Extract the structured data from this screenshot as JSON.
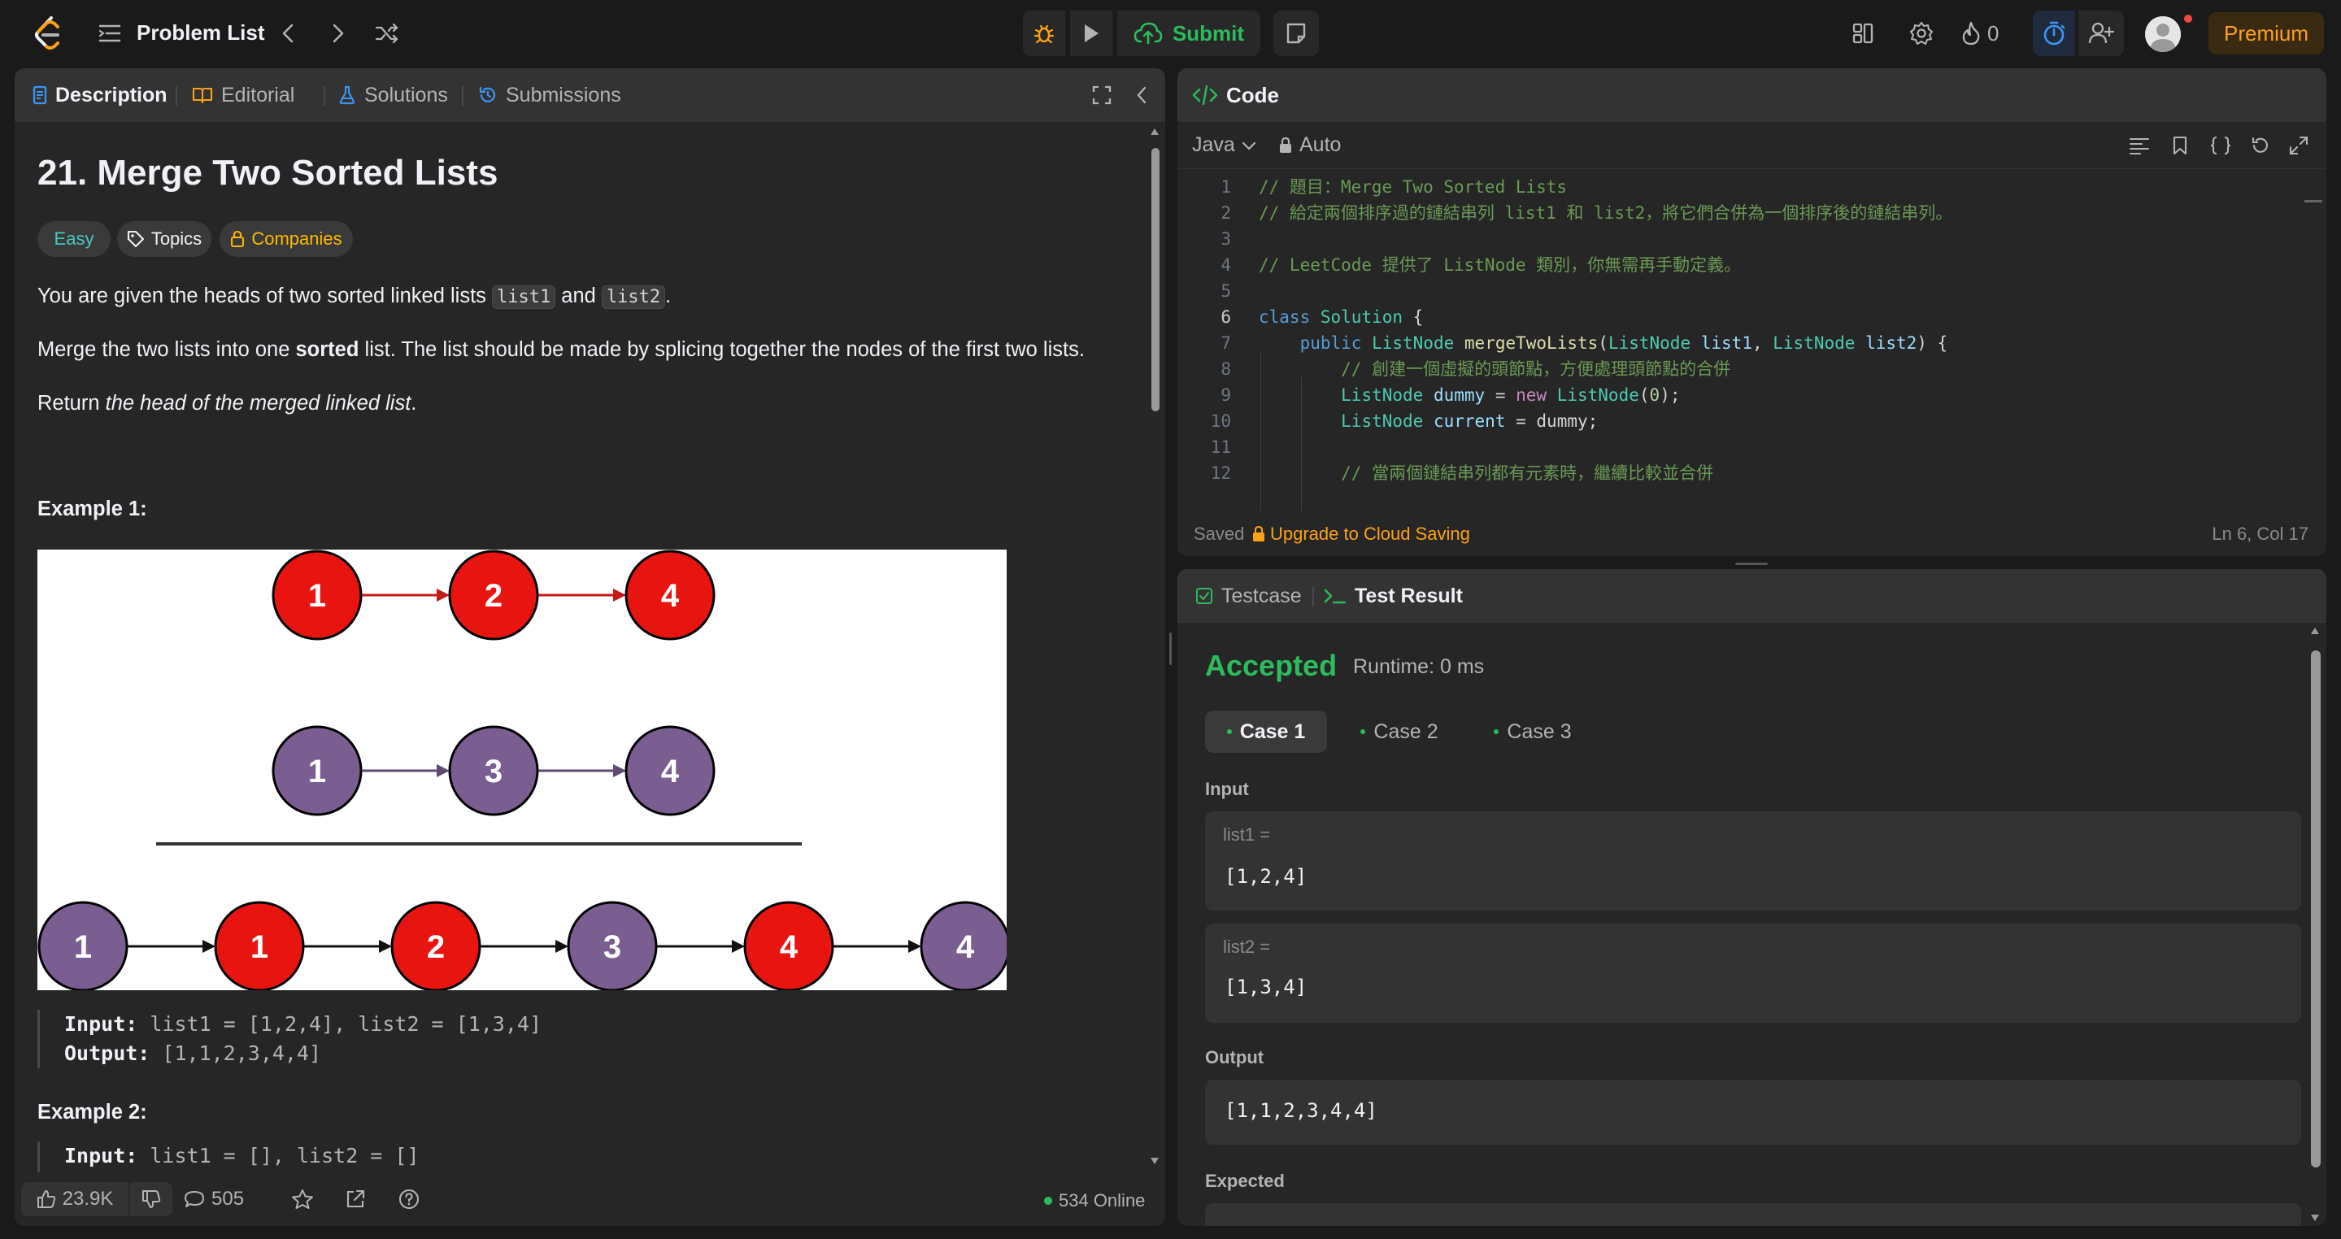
{
  "topbar": {
    "problem_list_label": "Problem List",
    "submit_label": "Submit",
    "streak_count": "0",
    "premium_label": "Premium"
  },
  "left": {
    "tabs": [
      {
        "label": "Description"
      },
      {
        "label": "Editorial"
      },
      {
        "label": "Solutions"
      },
      {
        "label": "Submissions"
      }
    ],
    "title": "21. Merge Two Sorted Lists",
    "difficulty": "Easy",
    "topics_label": "Topics",
    "companies_label": "Companies",
    "p1": {
      "a": "You are given the heads of two sorted linked lists ",
      "code1": "list1",
      "b": " and ",
      "code2": "list2",
      "c": "."
    },
    "p2": {
      "a": "Merge the two lists into one ",
      "bold": "sorted",
      "b": " list. The list should be made by splicing together the nodes of the first two lists."
    },
    "p3": {
      "a": "Return ",
      "em": "the head of the merged linked list",
      "b": "."
    },
    "example1": {
      "heading": "Example 1:",
      "input_label": "Input:",
      "input_value": "list1 = [1,2,4], list2 = [1,3,4]",
      "output_label": "Output:",
      "output_value": "[1,1,2,3,4,4]"
    },
    "example2": {
      "heading": "Example 2:",
      "input_label": "Input:",
      "input_value": "list1 = [], list2 = []"
    },
    "diagram": {
      "row1": [
        "1",
        "2",
        "4"
      ],
      "row2": [
        "1",
        "3",
        "4"
      ],
      "row3": [
        "1",
        "1",
        "2",
        "3",
        "4",
        "4"
      ],
      "red": "#e8140f",
      "purple": "#7a5e92"
    },
    "footer": {
      "likes": "23.9K",
      "comments": "505",
      "online": "534 Online"
    }
  },
  "code": {
    "title": "Code",
    "language": "Java",
    "mode": "Auto",
    "saved_label": "Saved",
    "upgrade_label": "Upgrade to Cloud Saving",
    "cursor": "Ln 6, Col 17",
    "line_numbers": [
      "1",
      "2",
      "3",
      "4",
      "5",
      "6",
      "7",
      "8",
      "9",
      "10",
      "11",
      "12"
    ]
  },
  "result": {
    "testcase_tab": "Testcase",
    "result_tab": "Test Result",
    "status": "Accepted",
    "runtime": "Runtime: 0 ms",
    "cases": [
      "Case 1",
      "Case 2",
      "Case 3"
    ],
    "input_label": "Input",
    "inputs": [
      {
        "name": "list1 =",
        "value": "[1,2,4]"
      },
      {
        "name": "list2 =",
        "value": "[1,3,4]"
      }
    ],
    "output_label": "Output",
    "output_value": "[1,1,2,3,4,4]",
    "expected_label": "Expected"
  },
  "colors": {
    "accent_green": "#2cbb5d",
    "accent_orange": "#ffa116",
    "easy_teal": "#46c6c2",
    "bg": "#1a1a1a",
    "panel": "#262626"
  },
  "icons": [
    "logo-icon",
    "problem-list-icon",
    "chevron-left-icon",
    "chevron-right-icon",
    "shuffle-icon",
    "debug-icon",
    "play-icon",
    "cloud-upload-icon",
    "note-icon",
    "layout-icon",
    "gear-icon",
    "flame-icon",
    "timer-icon",
    "add-user-icon",
    "avatar",
    "document-icon",
    "book-icon",
    "flask-icon",
    "history-icon",
    "expand-icon",
    "collapse-icon",
    "tag-icon",
    "lock-icon",
    "thumbs-up-icon",
    "thumbs-down-icon",
    "comment-icon",
    "star-icon",
    "share-icon",
    "help-icon",
    "code-icon",
    "chevron-down-icon",
    "format-icon",
    "bookmark-icon",
    "braces-icon",
    "reset-icon",
    "fullscreen-icon",
    "checkbox-icon",
    "terminal-icon"
  ]
}
